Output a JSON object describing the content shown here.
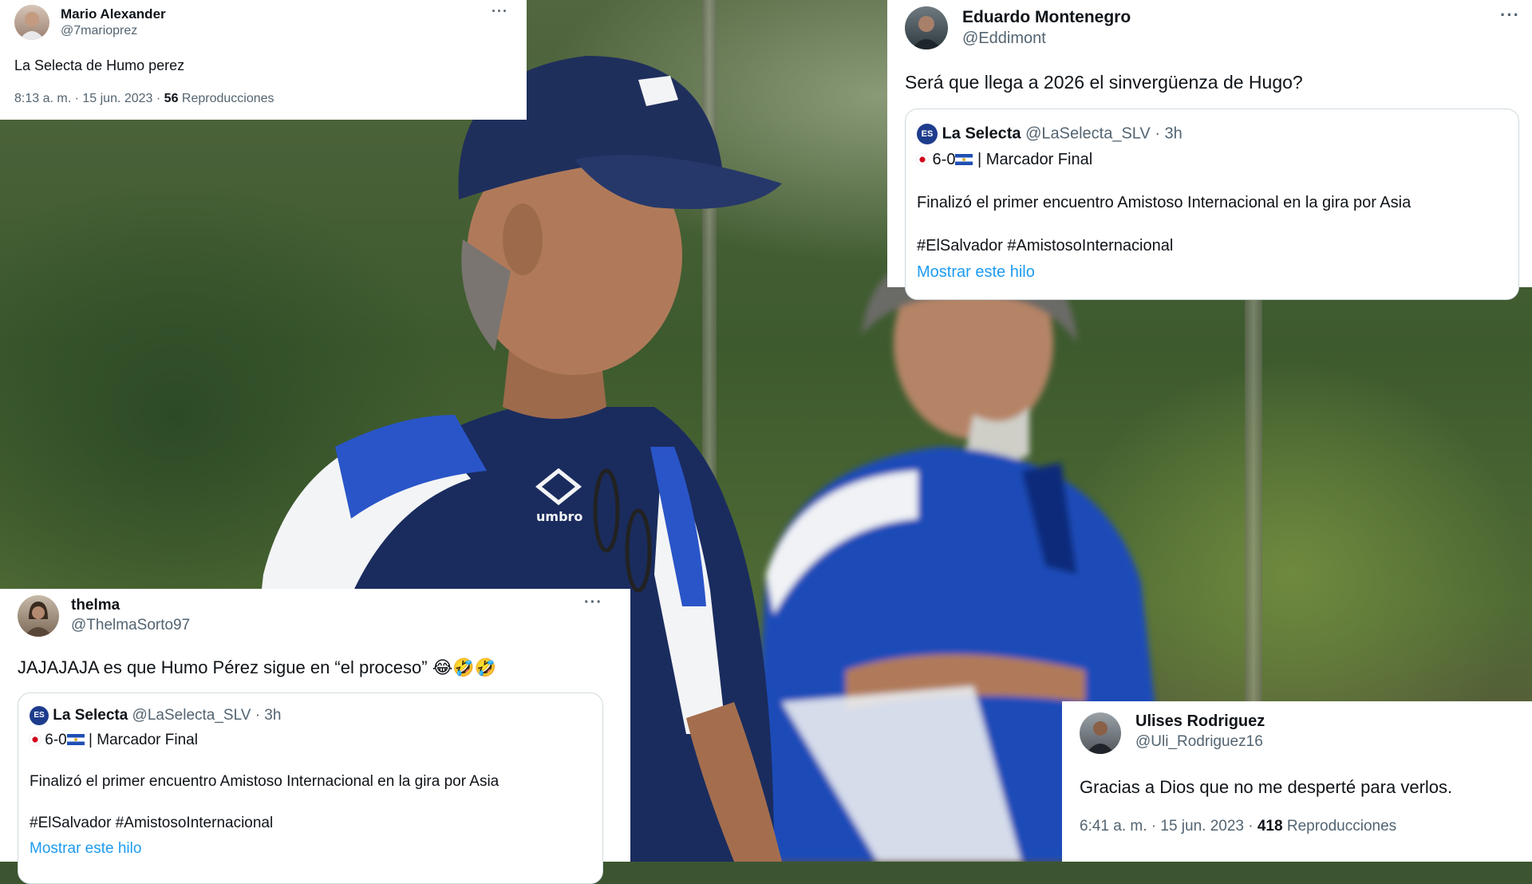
{
  "tweets": {
    "mario": {
      "name": "Mario Alexander",
      "handle": "@7marioprez",
      "text": "La Selecta de Humo perez",
      "time": "8:13 a. m. · 15 jun. 2023 · ",
      "views_count": "56",
      "views_label": " Reproducciones",
      "more_label": "···"
    },
    "eduardo": {
      "name": "Eduardo Montenegro",
      "handle": "@Eddimont",
      "text": "Será que llega a 2026 el sinvergüenza de Hugo?",
      "more_label": "···",
      "quote": {
        "logo": "ES",
        "name": "La Selecta",
        "handle": " @LaSelecta_SLV · 3h",
        "score": " 6-0",
        "score_label": " | Marcador Final",
        "body": "Finalizó el primer encuentro Amistoso Internacional en la gira por Asia",
        "hashtags": "#ElSalvador #AmistosoInternacional",
        "show_thread": "Mostrar este hilo"
      }
    },
    "thelma": {
      "name": "thelma",
      "handle": "@ThelmaSorto97",
      "text": "JAJAJAJA es que Humo Pérez sigue en “el proceso” 😂🤣🤣",
      "more_label": "···",
      "quote": {
        "logo": "ES",
        "name": "La Selecta",
        "handle": " @LaSelecta_SLV · 3h",
        "score": " 6-0",
        "score_label": " | Marcador Final",
        "body": "Finalizó el primer encuentro Amistoso Internacional en la gira por Asia",
        "hashtags": "#ElSalvador #AmistosoInternacional",
        "show_thread": "Mostrar este hilo"
      }
    },
    "ulises": {
      "name": "Ulises Rodriguez",
      "handle": "@Uli_Rodriguez16",
      "text": "Gracias a Dios que no me desperté para verlos.",
      "time": "6:41 a. m. · 15 jun. 2023 · ",
      "views_count": "418",
      "views_label": " Reproducciones"
    }
  },
  "photo": {
    "cap_logo": "ES",
    "shirt_brand": "umbro",
    "colors": {
      "navy": "#1a2c5e",
      "blue": "#2a55c8",
      "white": "#f3f4f6",
      "skin": "#b07a5a"
    }
  },
  "colors": {
    "link": "#1d9bf0",
    "muted": "#536471",
    "text": "#0f1419"
  }
}
